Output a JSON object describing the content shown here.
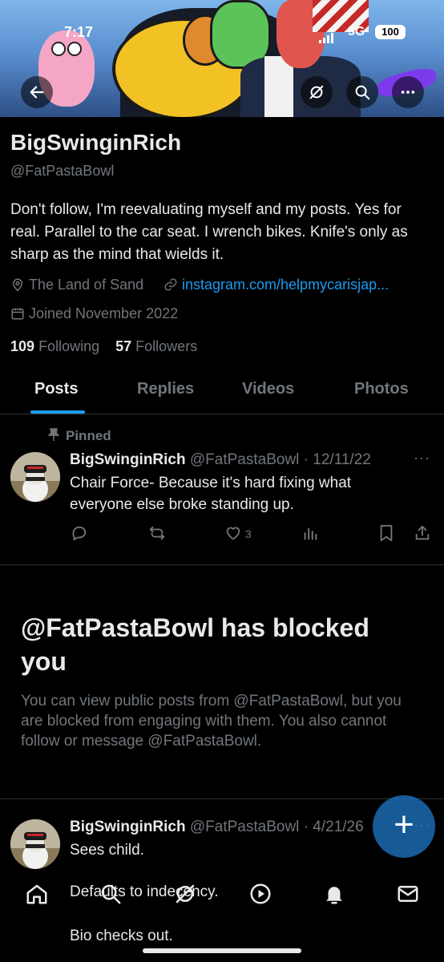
{
  "status_bar": {
    "time": "7:17",
    "network": "5G",
    "battery": "100"
  },
  "profile": {
    "name": "BigSwinginRich",
    "handle": "@FatPastaBowl",
    "bio": "Don't follow, I'm reevaluating myself and my posts. Yes for real. Parallel to the car seat. I wrench bikes. Knife's only as sharp as the mind that wields it.",
    "location": "The Land of Sand",
    "website": "instagram.com/helpmycarisjap...",
    "joined": "Joined November 2022",
    "following_count": "109",
    "following_label": "Following",
    "followers_count": "57",
    "followers_label": "Followers"
  },
  "tabs": [
    {
      "label": "Posts"
    },
    {
      "label": "Replies"
    },
    {
      "label": "Videos"
    },
    {
      "label": "Photos"
    }
  ],
  "pinned_post": {
    "pinned_label": "Pinned",
    "name": "BigSwinginRich",
    "meta": "@FatPastaBowl · 12/11/22",
    "text": "Chair Force- Because it's hard fixing what everyone else broke standing up.",
    "likes": "3"
  },
  "blocked": {
    "title": "@FatPastaBowl has blocked you",
    "text": "You can view public posts from @FatPastaBowl, but you are blocked from engaging with them. You also cannot follow or message @FatPastaBowl."
  },
  "second_post": {
    "name": "BigSwinginRich",
    "meta": "@FatPastaBowl · 4/21/26",
    "line1": "Sees child.",
    "line2": "Defaults to indecency.",
    "line3": "Bio checks out."
  },
  "fab": {
    "label": "+"
  },
  "colors": {
    "accent": "#1d9bf0",
    "muted": "#71767b",
    "text": "#e7e9ea",
    "background": "#000000"
  }
}
